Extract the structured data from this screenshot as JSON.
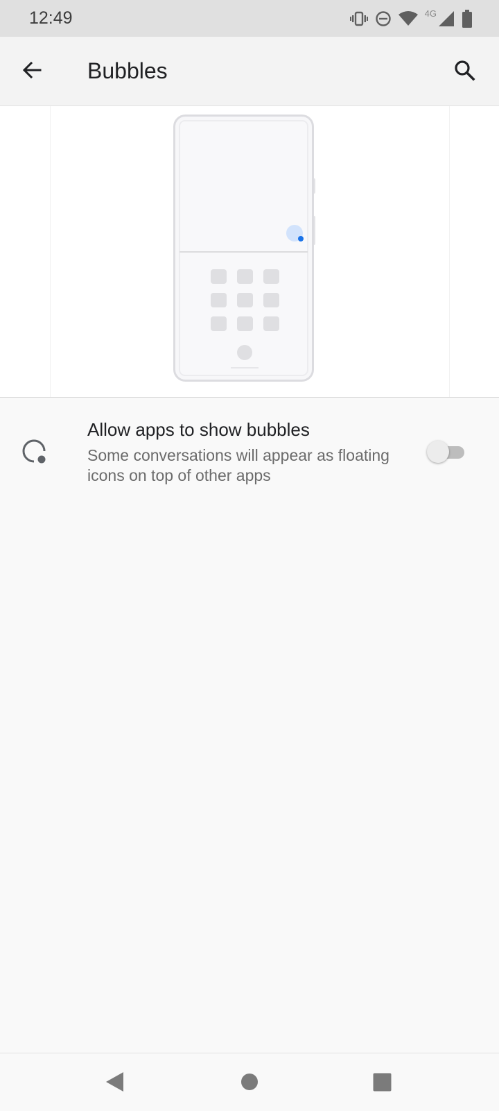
{
  "status_bar": {
    "time": "12:49",
    "network_label": "4G",
    "icons": [
      "vibrate-icon",
      "do-not-disturb-icon",
      "wifi-icon",
      "cell-signal-icon",
      "battery-icon"
    ]
  },
  "header": {
    "title": "Bubbles",
    "back_icon": "arrow-back-icon",
    "search_icon": "search-icon"
  },
  "illustration": {
    "description_icon": "phone-bubble-illustration",
    "accent_color": "#1a73e8",
    "bubble_color": "#d2e3fc"
  },
  "setting": {
    "icon": "bubble-icon",
    "title": "Allow apps to show bubbles",
    "description": "Some conversations will appear as floating icons on top of other apps",
    "toggle_on": false
  },
  "nav_bar": {
    "icons": [
      "nav-back-icon",
      "nav-home-icon",
      "nav-recents-icon"
    ]
  }
}
